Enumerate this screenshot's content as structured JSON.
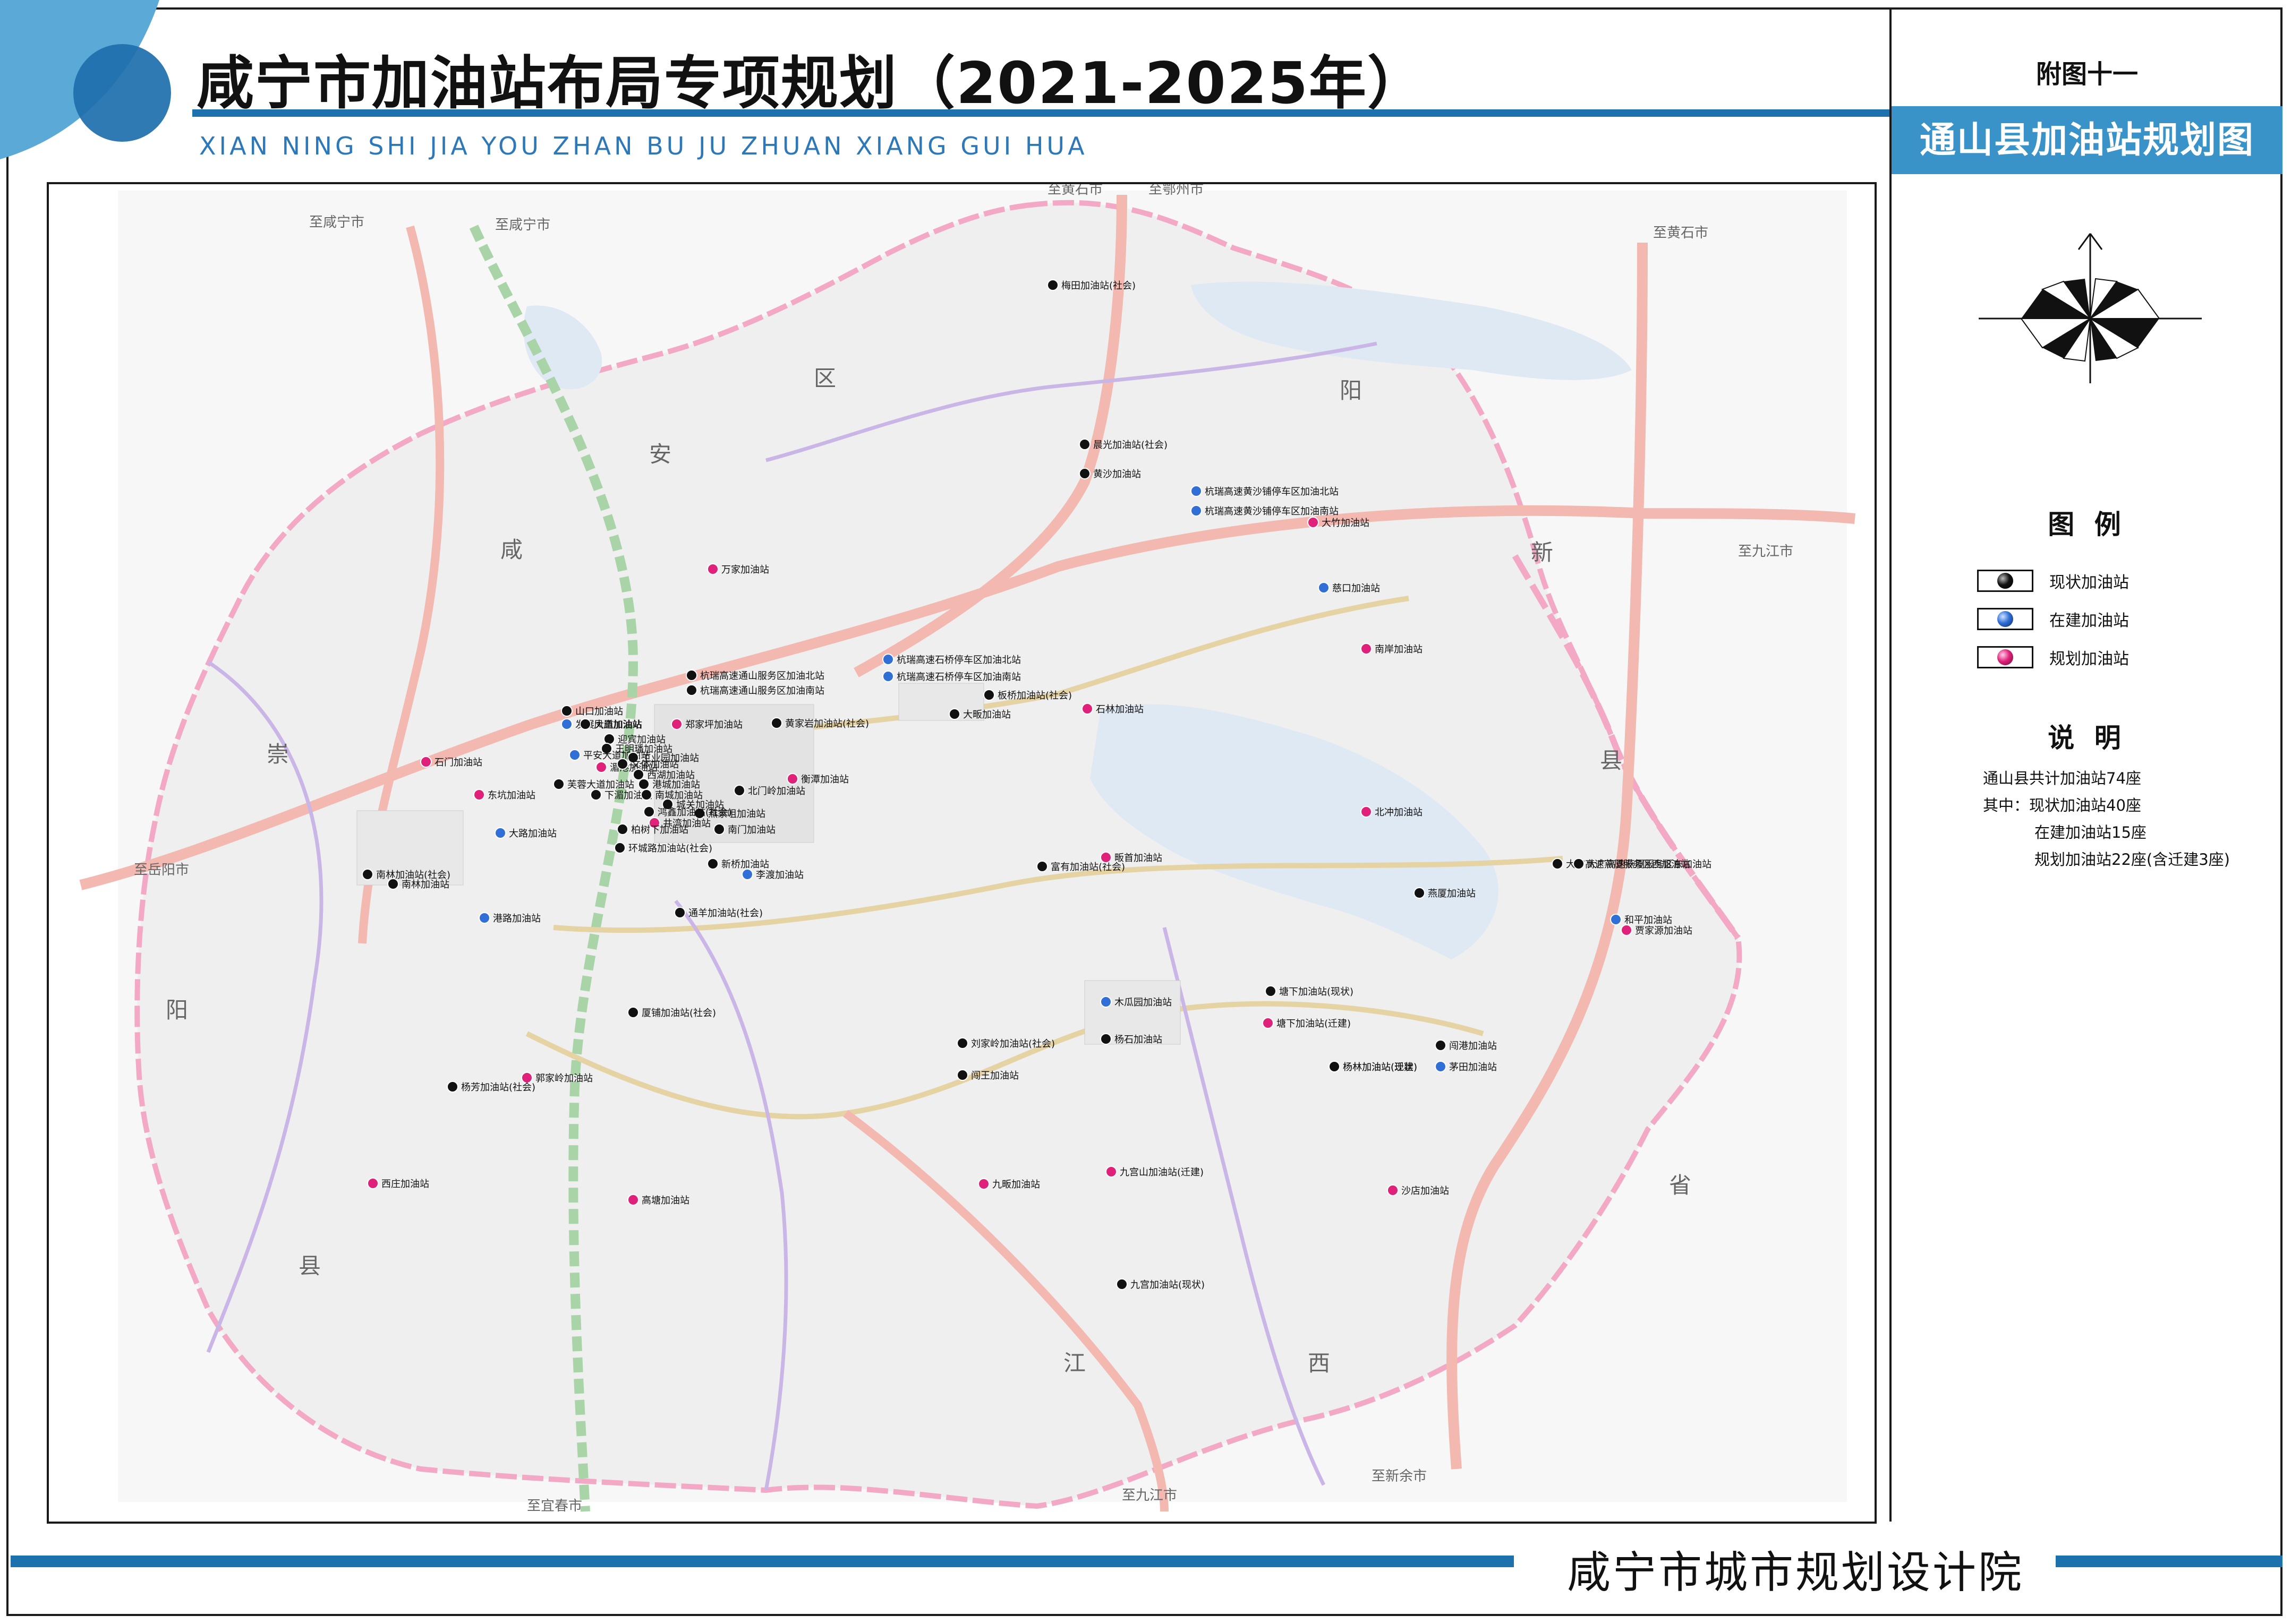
{
  "header": {
    "title": "咸宁市加油站布局专项规划（2021-2025年）",
    "subtitle": "XIAN NING SHI JIA YOU ZHAN BU JU ZHUAN XIANG GUI HUA"
  },
  "sidebar": {
    "annex_label": "附图十一",
    "map_title": "通山县加油站规划图",
    "legend": {
      "title": "图 例",
      "items": [
        {
          "label": "现状加油站",
          "color": "#111111"
        },
        {
          "label": "在建加油站",
          "color": "#2f6fd6"
        },
        {
          "label": "规划加油站",
          "color": "#e0217a"
        }
      ]
    },
    "notes": {
      "title": "说 明",
      "lines": [
        "通山县共计加油站74座",
        "其中：现状加油站40座",
        "在建加油站15座",
        "规划加油站22座(含迁建3座)"
      ]
    }
  },
  "footer": {
    "institute": "咸宁市城市规划设计院"
  },
  "map": {
    "colors": {
      "county_boundary": "#f3a9c5",
      "expressway": "#f3b8b0",
      "railway": "#a8d4a8",
      "provincial_road": "#c9b6e6",
      "local_road": "#e6d3a4",
      "water": "#d4e6f2",
      "terrain": "#ededed"
    },
    "region_labels": [
      {
        "text": "区"
      },
      {
        "text": "安"
      },
      {
        "text": "咸"
      },
      {
        "text": "崇"
      },
      {
        "text": "阳"
      },
      {
        "text": "县"
      },
      {
        "text": "阳"
      },
      {
        "text": "新"
      },
      {
        "text": "县"
      },
      {
        "text": "江"
      },
      {
        "text": "西"
      },
      {
        "text": "省"
      }
    ],
    "destinations": [
      {
        "text": "至咸宁市"
      },
      {
        "text": "至咸宁市"
      },
      {
        "text": "至黄石市"
      },
      {
        "text": "至鄂州市"
      },
      {
        "text": "至黄石市"
      },
      {
        "text": "至九江市"
      },
      {
        "text": "至岳阳市"
      },
      {
        "text": "至宜春市"
      },
      {
        "text": "至九江市"
      },
      {
        "text": "至新余市"
      }
    ],
    "stations": [
      {
        "name": "梅田加油站(社会)",
        "type": "existing"
      },
      {
        "name": "晨光加油站(社会)",
        "type": "existing"
      },
      {
        "name": "黄沙加油站",
        "type": "existing"
      },
      {
        "name": "杭瑞高速黄沙铺停车区加油北站",
        "type": "construction"
      },
      {
        "name": "杭瑞高速黄沙铺停车区加油南站",
        "type": "construction"
      },
      {
        "name": "大竹加油站",
        "type": "planned"
      },
      {
        "name": "慈口加油站",
        "type": "construction"
      },
      {
        "name": "南岸加油站",
        "type": "planned"
      },
      {
        "name": "万家加油站",
        "type": "planned"
      },
      {
        "name": "杭瑞高速石桥停车区加油北站",
        "type": "construction"
      },
      {
        "name": "杭瑞高速石桥停车区加油南站",
        "type": "construction"
      },
      {
        "name": "杭瑞高速通山服务区加油北站",
        "type": "existing"
      },
      {
        "name": "杭瑞高速通山服务区加油南站",
        "type": "existing"
      },
      {
        "name": "板桥加油站(社会)",
        "type": "existing"
      },
      {
        "name": "大畈加油站",
        "type": "existing"
      },
      {
        "name": "石林加油站",
        "type": "planned"
      },
      {
        "name": "山口加油站",
        "type": "existing"
      },
      {
        "name": "发展大道加油站",
        "type": "construction"
      },
      {
        "name": "凤凰加油站",
        "type": "existing"
      },
      {
        "name": "郑家坪加油站",
        "type": "planned"
      },
      {
        "name": "黄家岩加油站(社会)",
        "type": "existing"
      },
      {
        "name": "迎宾加油站",
        "type": "existing"
      },
      {
        "name": "王明璠加油站",
        "type": "existing"
      },
      {
        "name": "平安大道加油站",
        "type": "construction"
      },
      {
        "name": "工业园加油站",
        "type": "existing"
      },
      {
        "name": "湄港加油站",
        "type": "planned"
      },
      {
        "name": "石门加油站",
        "type": "planned"
      },
      {
        "name": "文体加油站",
        "type": "existing"
      },
      {
        "name": "西湖加油站",
        "type": "existing"
      },
      {
        "name": "芙蓉大道加油站",
        "type": "existing"
      },
      {
        "name": "港城加油站",
        "type": "existing"
      },
      {
        "name": "衡潭加油站",
        "type": "planned"
      },
      {
        "name": "东坑加油站",
        "type": "planned"
      },
      {
        "name": "下湄加油站",
        "type": "existing"
      },
      {
        "name": "北门岭加油站",
        "type": "existing"
      },
      {
        "name": "南城加油站",
        "type": "existing"
      },
      {
        "name": "大路加油站",
        "type": "construction"
      },
      {
        "name": "城关加油站",
        "type": "existing"
      },
      {
        "name": "燕家咀加油站",
        "type": "existing"
      },
      {
        "name": "鸿鑫加油站(社会)",
        "type": "existing"
      },
      {
        "name": "井湾加油站",
        "type": "planned"
      },
      {
        "name": "南门加油站",
        "type": "existing"
      },
      {
        "name": "柏树下加油站",
        "type": "existing"
      },
      {
        "name": "环城路加油站(社会)",
        "type": "existing"
      },
      {
        "name": "新桥加油站",
        "type": "existing"
      },
      {
        "name": "李渡加油站",
        "type": "construction"
      },
      {
        "name": "南林加油站(社会)",
        "type": "existing"
      },
      {
        "name": "南林加油站",
        "type": "existing"
      },
      {
        "name": "通羊加油站(社会)",
        "type": "existing"
      },
      {
        "name": "港路加油站",
        "type": "construction"
      },
      {
        "name": "富有加油站(社会)",
        "type": "existing"
      },
      {
        "name": "畈首加油站",
        "type": "planned"
      },
      {
        "name": "北冲加油站",
        "type": "planned"
      },
      {
        "name": "大广高速燕厦服务区西加油站",
        "type": "existing"
      },
      {
        "name": "大广高速燕厦服务区东加油站",
        "type": "existing"
      },
      {
        "name": "燕厦加油站",
        "type": "existing"
      },
      {
        "name": "和平加油站",
        "type": "construction"
      },
      {
        "name": "贾家源加油站",
        "type": "planned"
      },
      {
        "name": "厦铺加油站(社会)",
        "type": "existing"
      },
      {
        "name": "木瓜园加油站",
        "type": "construction"
      },
      {
        "name": "塘下加油站(现状)",
        "type": "existing"
      },
      {
        "name": "塘下加油站(迁建)",
        "type": "planned"
      },
      {
        "name": "杨石加油站",
        "type": "existing"
      },
      {
        "name": "刘家岭加油站(社会)",
        "type": "existing"
      },
      {
        "name": "杨林加油站(迁建)",
        "type": "planned"
      },
      {
        "name": "杨林加油站(现状)",
        "type": "existing"
      },
      {
        "name": "闯港加油站",
        "type": "existing"
      },
      {
        "name": "茅田加油站",
        "type": "construction"
      },
      {
        "name": "闯王加油站",
        "type": "existing"
      },
      {
        "name": "郭家岭加油站",
        "type": "planned"
      },
      {
        "name": "杨芳加油站(社会)",
        "type": "existing"
      },
      {
        "name": "西庄加油站",
        "type": "planned"
      },
      {
        "name": "高塘加油站",
        "type": "planned"
      },
      {
        "name": "九畈加油站",
        "type": "planned"
      },
      {
        "name": "九宫山加油站(迁建)",
        "type": "planned"
      },
      {
        "name": "沙店加油站",
        "type": "planned"
      },
      {
        "name": "九宫加油站(现状)",
        "type": "existing"
      }
    ]
  }
}
